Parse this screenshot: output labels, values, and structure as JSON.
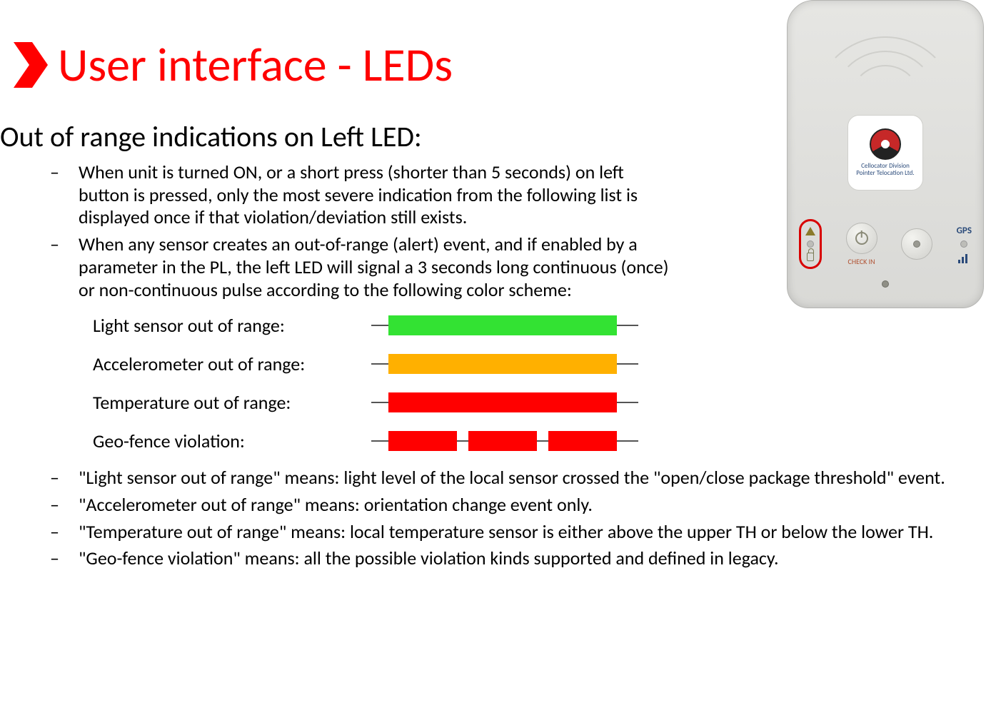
{
  "title": "User interface - LEDs",
  "subheading": "Out of range indications on Left LED:",
  "bullets_top": [
    "When unit is turned ON, or a short press (shorter than 5 seconds) on left button is pressed, only the most severe indication from the following list is displayed once if that violation/deviation still exists.",
    "When any sensor creates an out-of-range (alert) event, and if enabled by a parameter in the PL, the left LED will signal a 3 seconds long continuous (once) or non-continuous pulse according to the following color scheme:"
  ],
  "scheme": [
    {
      "label": "Light sensor out of range:",
      "color": "#33e233",
      "pattern": "solid"
    },
    {
      "label": "Accelerometer out of range:",
      "color": "#ffb000",
      "pattern": "solid"
    },
    {
      "label": "Temperature out of range:",
      "color": "#ff0000",
      "pattern": "solid"
    },
    {
      "label": "Geo-fence violation:",
      "color": "#ff0000",
      "pattern": "segmented"
    }
  ],
  "bullets_bottom": [
    "\"Light sensor out of range\" means: light level of the local sensor crossed the \"open/close package threshold\" event.",
    "\"Accelerometer out of range\" means: orientation change event only.",
    "\"Temperature out of range\" means: local temperature sensor is either above the upper TH or below the lower TH.",
    "\"Geo-fence violation\" means: all the possible violation kinds supported and defined in legacy."
  ],
  "device": {
    "brand_line1": "Cellocator Division",
    "brand_line2": "Pointer Telocation Ltd.",
    "checkin_label": "CHECK IN",
    "gps_label": "GPS"
  }
}
